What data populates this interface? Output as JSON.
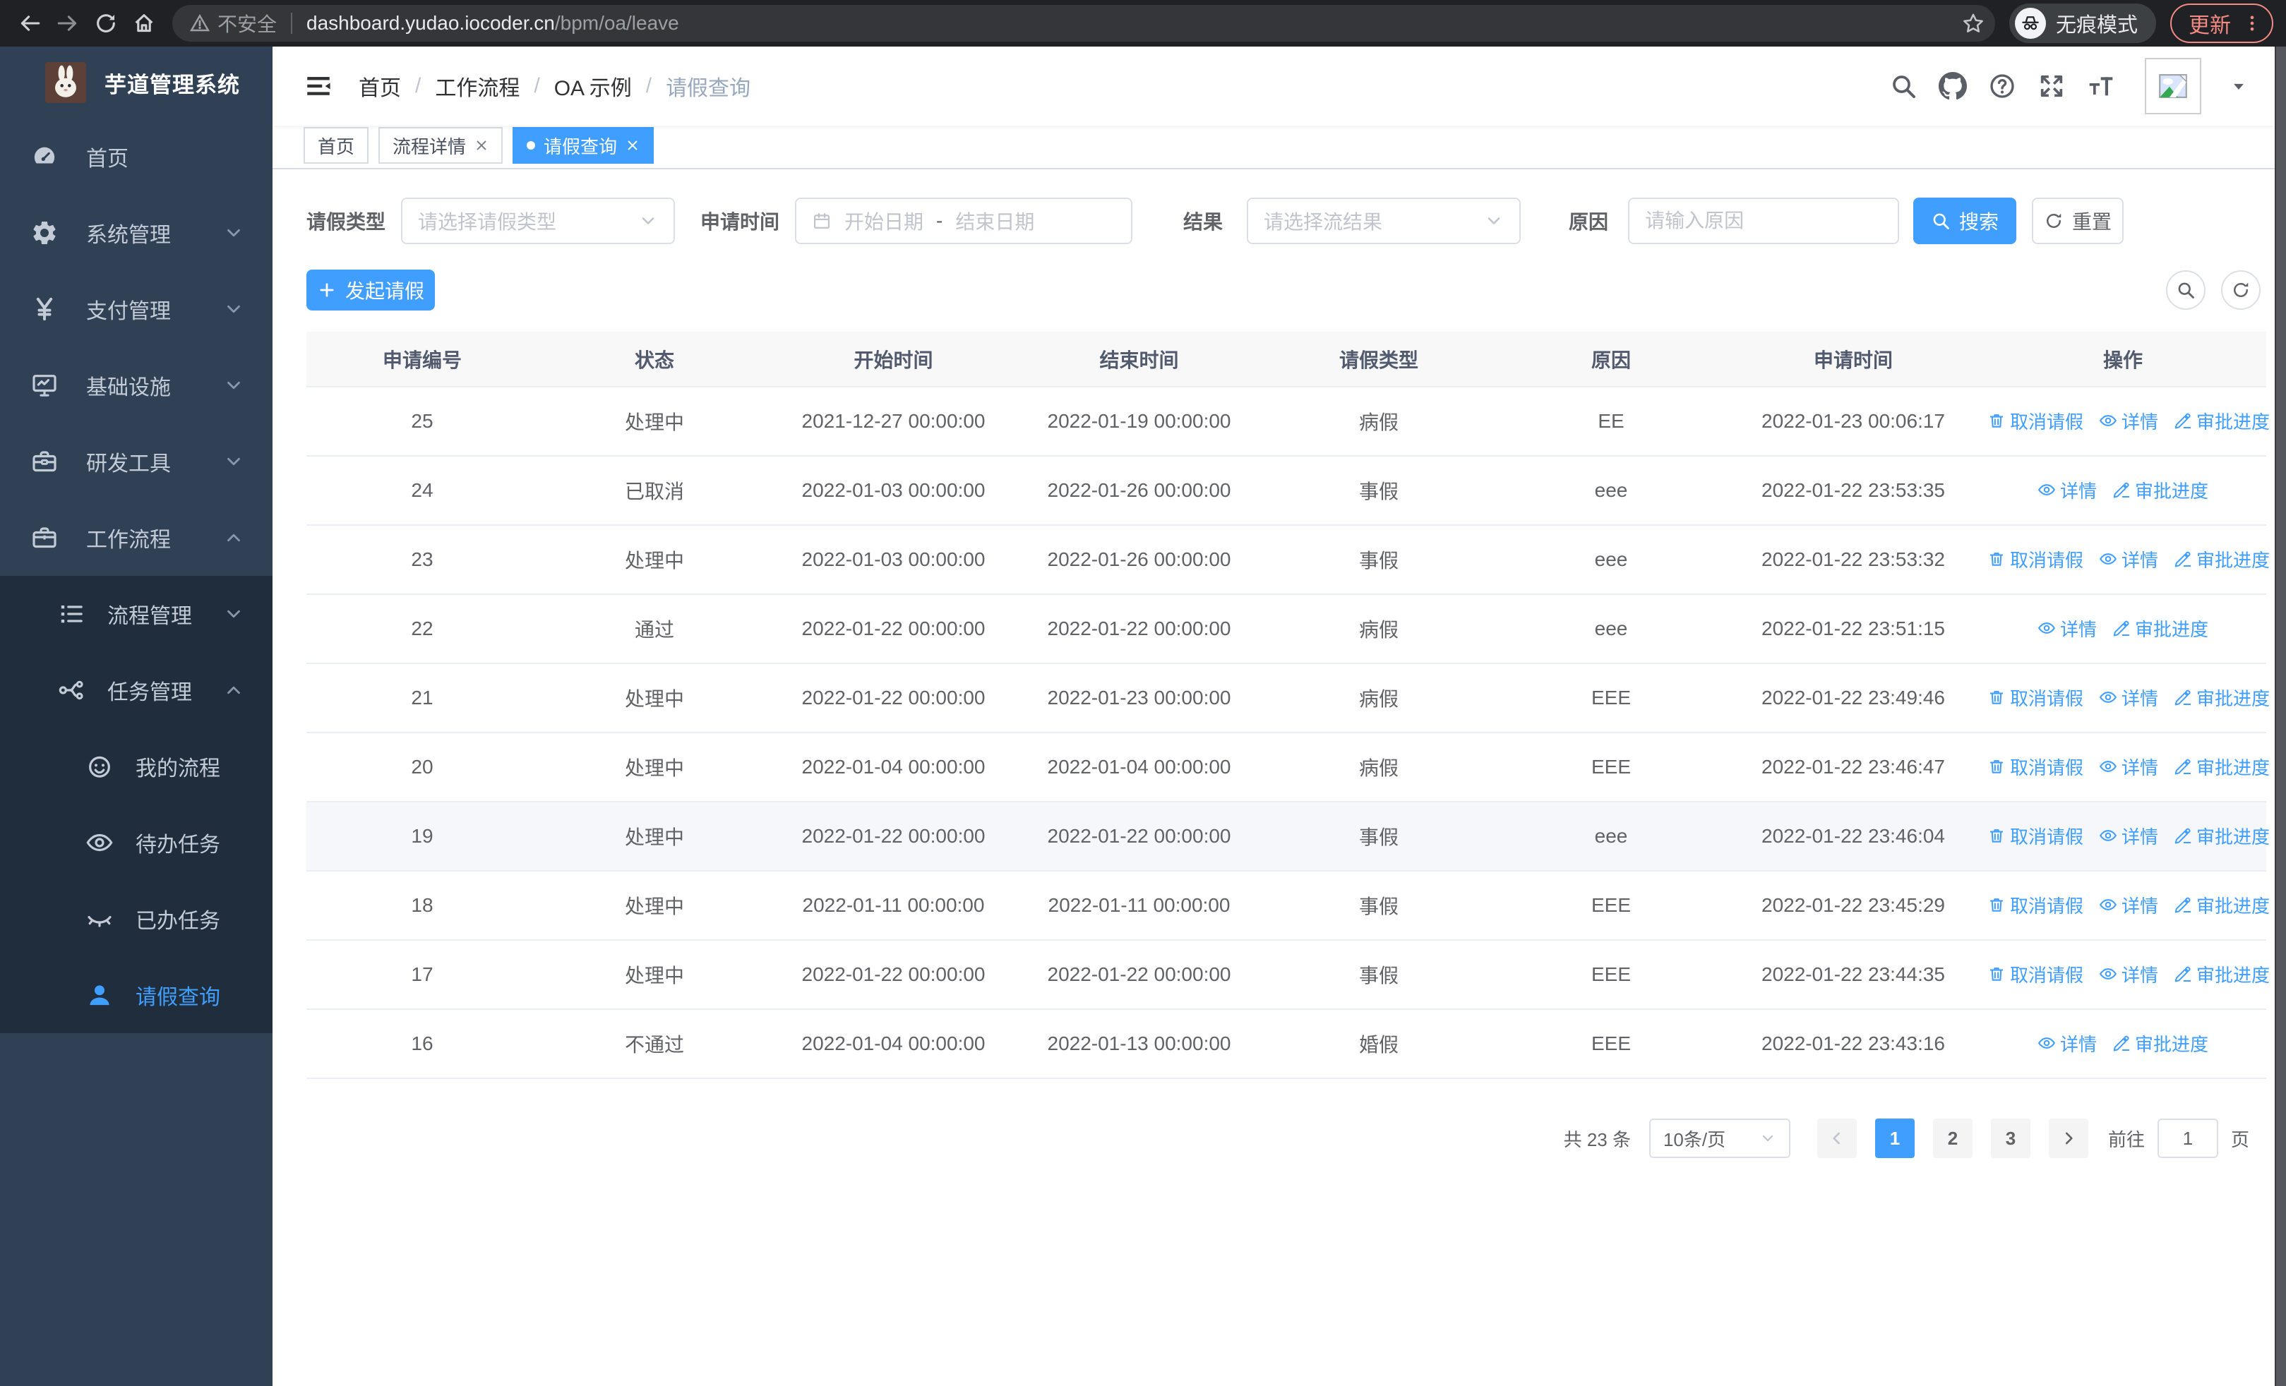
{
  "browser": {
    "security_label": "不安全",
    "url_host": "dashboard.yudao.iocoder.cn",
    "url_path": "/bpm/oa/leave",
    "incognito_label": "无痕模式",
    "update_label": "更新"
  },
  "sidebar": {
    "app_title": "芋道管理系统",
    "items": [
      {
        "label": "首页",
        "icon": "dashboard-icon"
      },
      {
        "label": "系统管理",
        "icon": "gear-icon"
      },
      {
        "label": "支付管理",
        "icon": "yen-icon"
      },
      {
        "label": "基础设施",
        "icon": "monitor-icon"
      },
      {
        "label": "研发工具",
        "icon": "toolbox-icon"
      },
      {
        "label": "工作流程",
        "icon": "briefcase-icon"
      }
    ],
    "submenu": [
      {
        "label": "流程管理",
        "icon": "list-icon"
      },
      {
        "label": "任务管理",
        "icon": "flow-icon"
      },
      {
        "label": "我的流程",
        "icon": "face-icon"
      },
      {
        "label": "待办任务",
        "icon": "eye-icon"
      },
      {
        "label": "已办任务",
        "icon": "eye-closed-icon"
      },
      {
        "label": "请假查询",
        "icon": "user-icon",
        "active": true
      }
    ]
  },
  "header": {
    "breadcrumb": [
      "首页",
      "工作流程",
      "OA 示例",
      "请假查询"
    ]
  },
  "tabs": [
    {
      "label": "首页"
    },
    {
      "label": "流程详情",
      "closable": true
    },
    {
      "label": "请假查询",
      "closable": true,
      "active": true
    }
  ],
  "filters": {
    "leave_type_label": "请假类型",
    "leave_type_placeholder": "请选择请假类型",
    "apply_time_label": "申请时间",
    "start_date_placeholder": "开始日期",
    "range_separator": "-",
    "end_date_placeholder": "结束日期",
    "result_label": "结果",
    "result_placeholder": "请选择流结果",
    "reason_label": "原因",
    "reason_placeholder": "请输入原因",
    "search_label": "搜索",
    "reset_label": "重置"
  },
  "toolbar": {
    "create_label": "发起请假"
  },
  "table": {
    "columns": [
      "申请编号",
      "状态",
      "开始时间",
      "结束时间",
      "请假类型",
      "原因",
      "申请时间",
      "操作"
    ],
    "rows": [
      {
        "id": "25",
        "status": "处理中",
        "start": "2021-12-27 00:00:00",
        "end": "2022-01-19 00:00:00",
        "type": "病假",
        "reason": "EE",
        "applied": "2022-01-23 00:06:17",
        "actions": [
          "取消请假",
          "详情",
          "审批进度"
        ]
      },
      {
        "id": "24",
        "status": "已取消",
        "start": "2022-01-03 00:00:00",
        "end": "2022-01-26 00:00:00",
        "type": "事假",
        "reason": "eee",
        "applied": "2022-01-22 23:53:35",
        "actions": [
          "详情",
          "审批进度"
        ]
      },
      {
        "id": "23",
        "status": "处理中",
        "start": "2022-01-03 00:00:00",
        "end": "2022-01-26 00:00:00",
        "type": "事假",
        "reason": "eee",
        "applied": "2022-01-22 23:53:32",
        "actions": [
          "取消请假",
          "详情",
          "审批进度"
        ]
      },
      {
        "id": "22",
        "status": "通过",
        "start": "2022-01-22 00:00:00",
        "end": "2022-01-22 00:00:00",
        "type": "病假",
        "reason": "eee",
        "applied": "2022-01-22 23:51:15",
        "actions": [
          "详情",
          "审批进度"
        ]
      },
      {
        "id": "21",
        "status": "处理中",
        "start": "2022-01-22 00:00:00",
        "end": "2022-01-23 00:00:00",
        "type": "病假",
        "reason": "EEE",
        "applied": "2022-01-22 23:49:46",
        "actions": [
          "取消请假",
          "详情",
          "审批进度"
        ]
      },
      {
        "id": "20",
        "status": "处理中",
        "start": "2022-01-04 00:00:00",
        "end": "2022-01-04 00:00:00",
        "type": "病假",
        "reason": "EEE",
        "applied": "2022-01-22 23:46:47",
        "actions": [
          "取消请假",
          "详情",
          "审批进度"
        ]
      },
      {
        "id": "19",
        "status": "处理中",
        "start": "2022-01-22 00:00:00",
        "end": "2022-01-22 00:00:00",
        "type": "事假",
        "reason": "eee",
        "applied": "2022-01-22 23:46:04",
        "actions": [
          "取消请假",
          "详情",
          "审批进度"
        ],
        "highlight": true
      },
      {
        "id": "18",
        "status": "处理中",
        "start": "2022-01-11 00:00:00",
        "end": "2022-01-11 00:00:00",
        "type": "事假",
        "reason": "EEE",
        "applied": "2022-01-22 23:45:29",
        "actions": [
          "取消请假",
          "详情",
          "审批进度"
        ]
      },
      {
        "id": "17",
        "status": "处理中",
        "start": "2022-01-22 00:00:00",
        "end": "2022-01-22 00:00:00",
        "type": "事假",
        "reason": "EEE",
        "applied": "2022-01-22 23:44:35",
        "actions": [
          "取消请假",
          "详情",
          "审批进度"
        ]
      },
      {
        "id": "16",
        "status": "不通过",
        "start": "2022-01-04 00:00:00",
        "end": "2022-01-13 00:00:00",
        "type": "婚假",
        "reason": "EEE",
        "applied": "2022-01-22 23:43:16",
        "actions": [
          "详情",
          "审批进度"
        ]
      }
    ]
  },
  "pagination": {
    "total_label": "共 23 条",
    "page_size": "10条/页",
    "pages": [
      "1",
      "2",
      "3"
    ],
    "active_page": "1",
    "goto_label": "前往",
    "goto_value": "1",
    "page_unit": "页"
  },
  "colors": {
    "primary": "#409eff",
    "sidebar_bg": "#304156",
    "submenu_bg": "#1f2d3d",
    "table_header_bg": "#f8f8f9",
    "update_accent": "#f28b82"
  }
}
